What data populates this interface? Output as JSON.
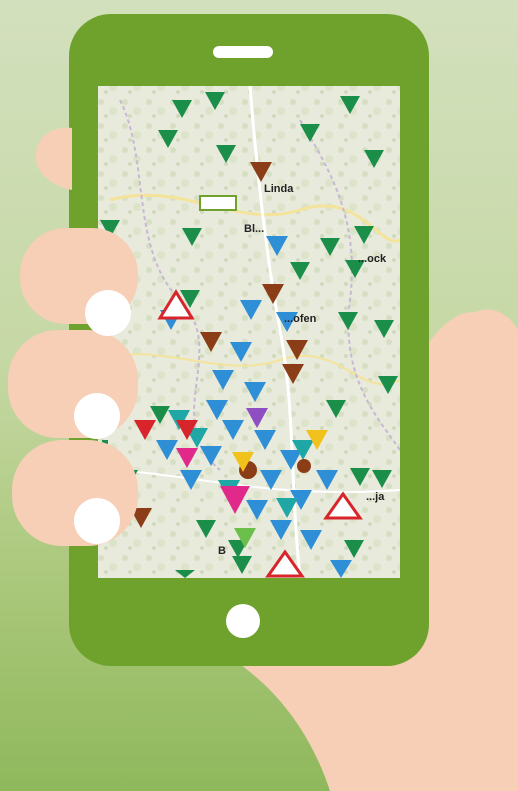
{
  "map": {
    "labels": [
      {
        "id": "label-a",
        "text": "Linda"
      },
      {
        "id": "label-b",
        "text": "Bl..."
      },
      {
        "id": "label-c",
        "text": "...ock"
      },
      {
        "id": "label-d",
        "text": "...ofen"
      },
      {
        "id": "label-e",
        "text": "...ja"
      },
      {
        "id": "label-f",
        "text": "B"
      }
    ]
  },
  "colors": {
    "background_top": "#d3e0bd",
    "background_bottom": "#8fb85c",
    "phone_body": "#6ea22d",
    "skin": "#f6cfb6",
    "fingernail": "#ffffff",
    "map_base": "#e9ebde",
    "marker_green": "#1b8f4a",
    "marker_blue": "#2f8fd6",
    "marker_brown": "#8a3d17",
    "marker_pink": "#e0298a",
    "marker_red": "#d8242b"
  }
}
